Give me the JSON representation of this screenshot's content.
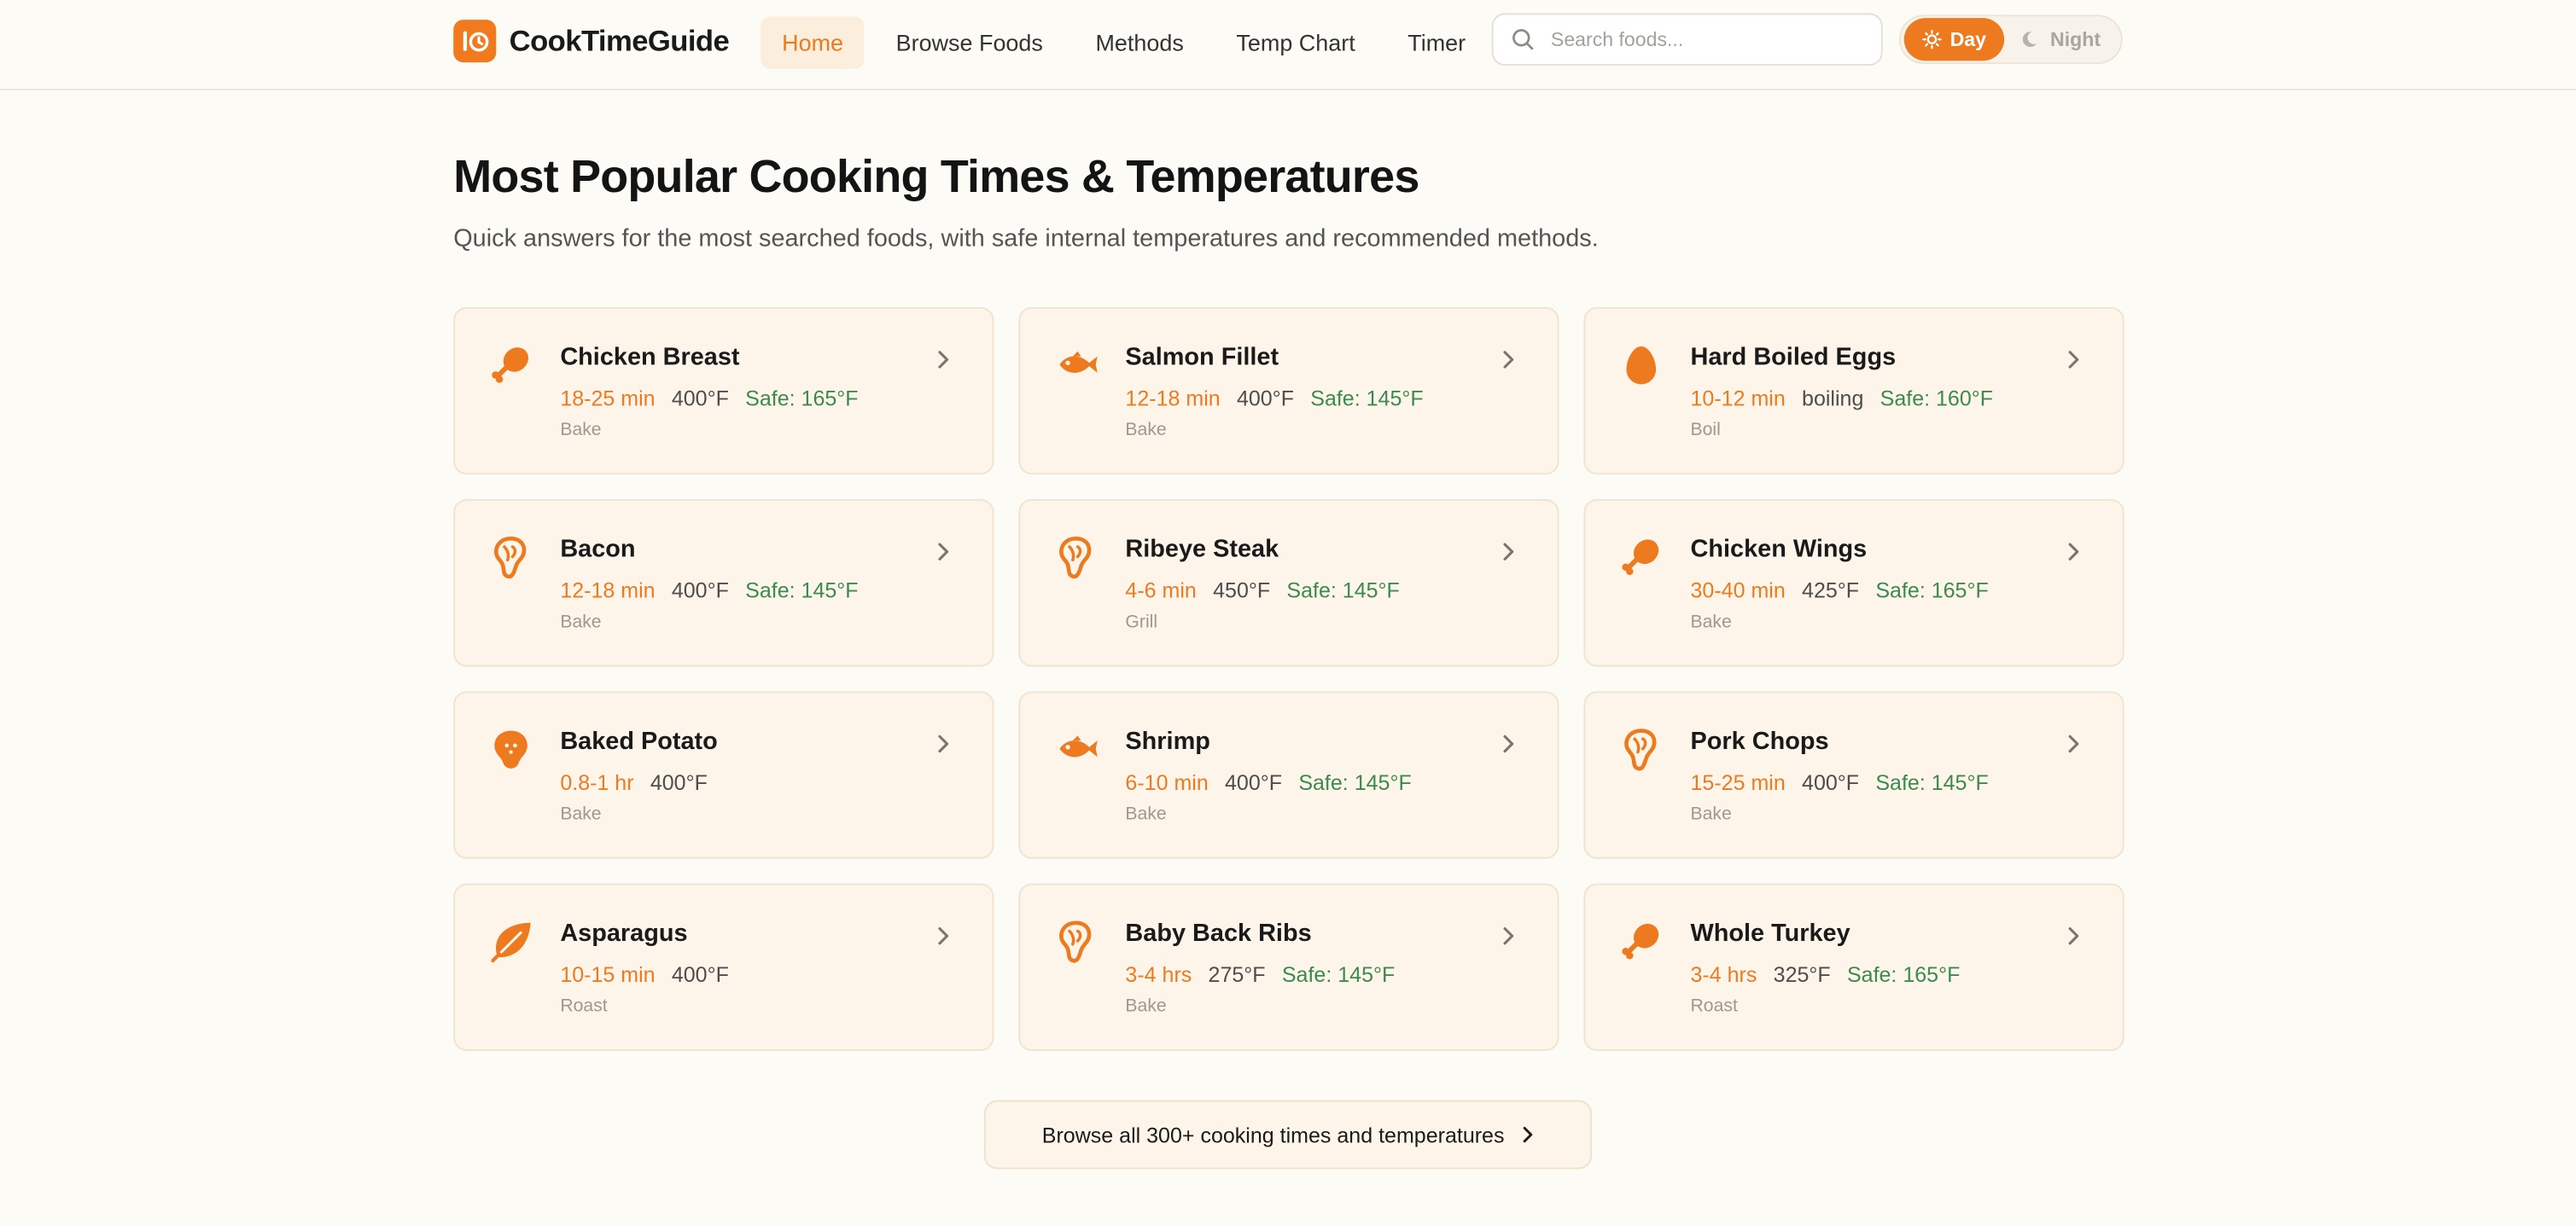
{
  "brand": {
    "name": "CookTimeGuide"
  },
  "nav": [
    {
      "label": "Home",
      "active": true
    },
    {
      "label": "Browse Foods",
      "active": false
    },
    {
      "label": "Methods",
      "active": false
    },
    {
      "label": "Temp Chart",
      "active": false
    },
    {
      "label": "Timer",
      "active": false
    }
  ],
  "search": {
    "placeholder": "Search foods...",
    "value": ""
  },
  "theme_toggle": {
    "day_label": "Day",
    "night_label": "Night",
    "selected": "Day"
  },
  "page": {
    "title": "Most Popular Cooking Times & Temperatures",
    "subtitle": "Quick answers for the most searched foods, with safe internal temperatures and recommended methods."
  },
  "foods": [
    {
      "name": "Chicken Breast",
      "time": "18-25 min",
      "temp": "400°F",
      "safe": "Safe: 165°F",
      "method": "Bake",
      "icon": "drumstick-icon"
    },
    {
      "name": "Salmon Fillet",
      "time": "12-18 min",
      "temp": "400°F",
      "safe": "Safe: 145°F",
      "method": "Bake",
      "icon": "fish-icon"
    },
    {
      "name": "Hard Boiled Eggs",
      "time": "10-12 min",
      "temp": "boiling",
      "safe": "Safe: 160°F",
      "method": "Boil",
      "icon": "egg-icon"
    },
    {
      "name": "Bacon",
      "time": "12-18 min",
      "temp": "400°F",
      "safe": "Safe: 145°F",
      "method": "Bake",
      "icon": "steak-icon"
    },
    {
      "name": "Ribeye Steak",
      "time": "4-6 min",
      "temp": "450°F",
      "safe": "Safe: 145°F",
      "method": "Grill",
      "icon": "steak-icon"
    },
    {
      "name": "Chicken Wings",
      "time": "30-40 min",
      "temp": "425°F",
      "safe": "Safe: 165°F",
      "method": "Bake",
      "icon": "drumstick-icon"
    },
    {
      "name": "Baked Potato",
      "time": "0.8-1 hr",
      "temp": "400°F",
      "safe": "",
      "method": "Bake",
      "icon": "potato-icon"
    },
    {
      "name": "Shrimp",
      "time": "6-10 min",
      "temp": "400°F",
      "safe": "Safe: 145°F",
      "method": "Bake",
      "icon": "fish-icon"
    },
    {
      "name": "Pork Chops",
      "time": "15-25 min",
      "temp": "400°F",
      "safe": "Safe: 145°F",
      "method": "Bake",
      "icon": "steak-icon"
    },
    {
      "name": "Asparagus",
      "time": "10-15 min",
      "temp": "400°F",
      "safe": "",
      "method": "Roast",
      "icon": "leaf-icon"
    },
    {
      "name": "Baby Back Ribs",
      "time": "3-4 hrs",
      "temp": "275°F",
      "safe": "Safe: 145°F",
      "method": "Bake",
      "icon": "steak-icon"
    },
    {
      "name": "Whole Turkey",
      "time": "3-4 hrs",
      "temp": "325°F",
      "safe": "Safe: 165°F",
      "method": "Roast",
      "icon": "drumstick-icon"
    }
  ],
  "browse_all": {
    "label": "Browse all 300+ cooking times and temperatures"
  },
  "colors": {
    "accent": "#ee7a1f",
    "safe": "#3b8a4e",
    "background": "#fdfbf5",
    "card": "#fdf5ea"
  }
}
